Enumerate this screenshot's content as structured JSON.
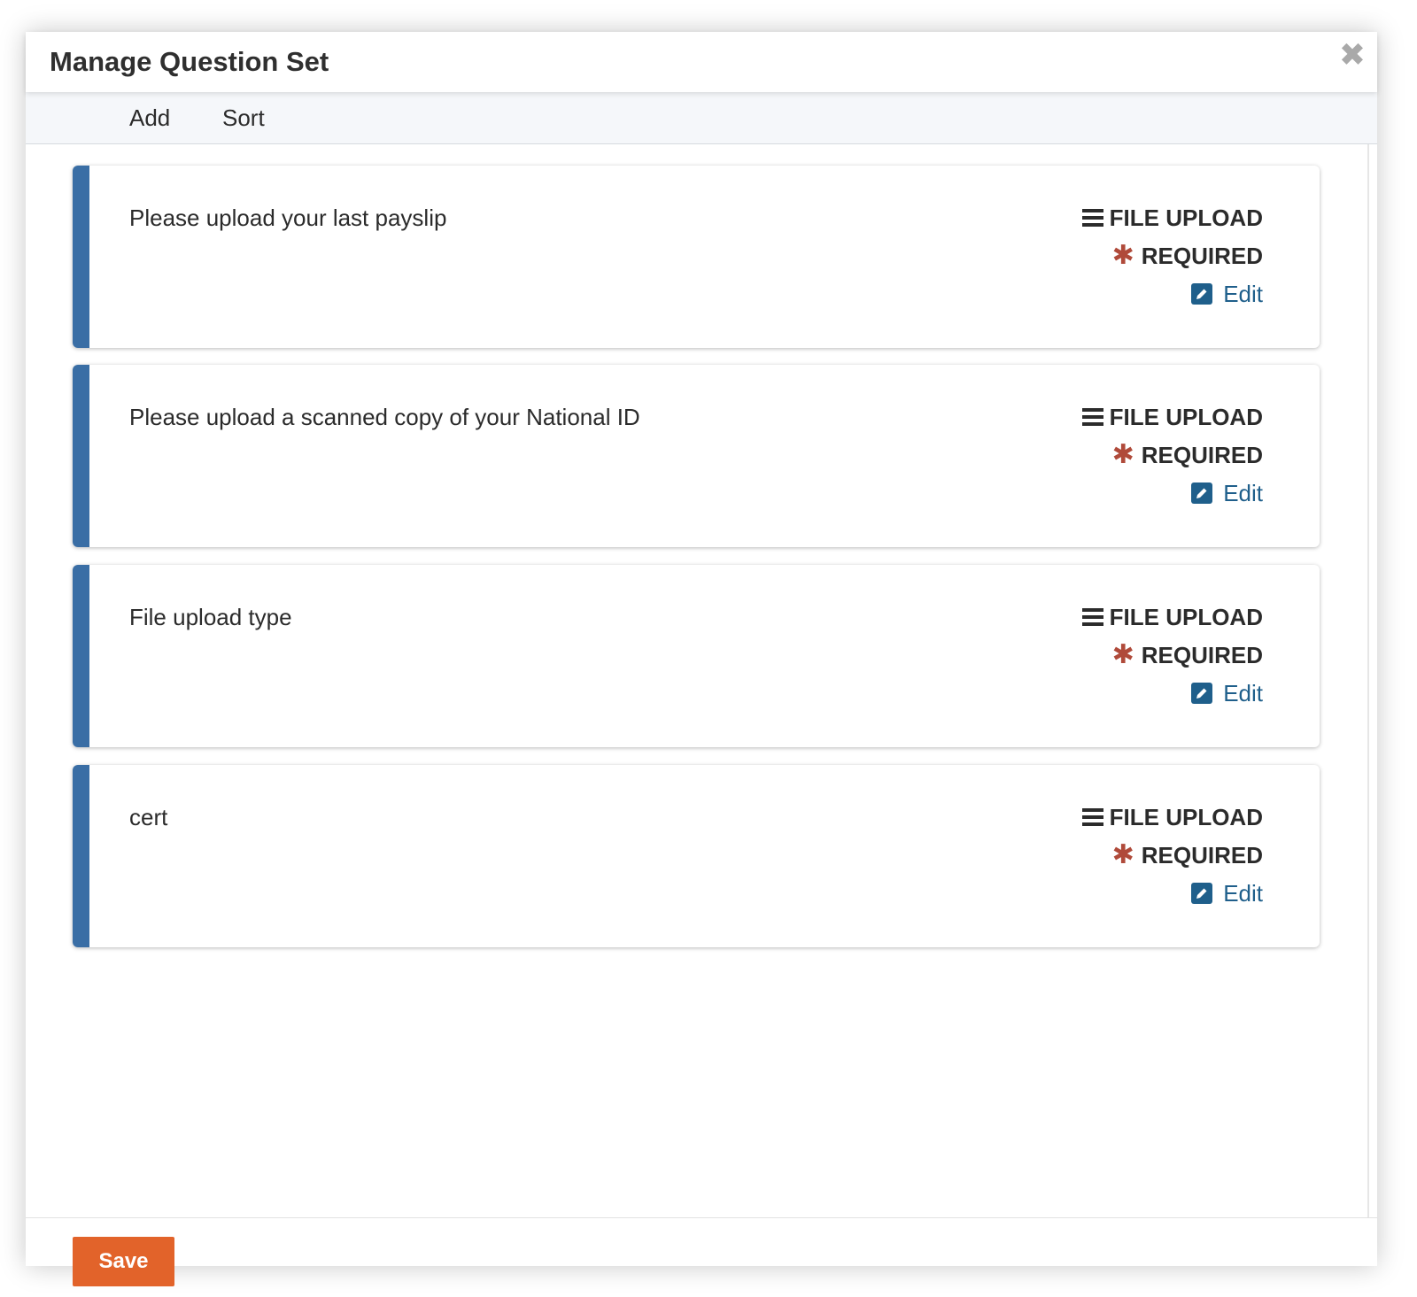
{
  "modal": {
    "title": "Manage Question Set",
    "close_icon": "close-icon"
  },
  "toolbar": {
    "add_label": "Add",
    "sort_label": "Sort"
  },
  "questions": [
    {
      "text": "Please upload your last payslip",
      "type": "FILE UPLOAD",
      "required": "REQUIRED",
      "edit": "Edit"
    },
    {
      "text": "Please upload a scanned copy of your National ID",
      "type": "FILE UPLOAD",
      "required": "REQUIRED",
      "edit": "Edit"
    },
    {
      "text": "File upload type",
      "type": "FILE UPLOAD",
      "required": "REQUIRED",
      "edit": "Edit"
    },
    {
      "text": "cert",
      "type": "FILE UPLOAD",
      "required": "REQUIRED",
      "edit": "Edit"
    }
  ],
  "footer": {
    "save_label": "Save"
  },
  "icons": {
    "type": "list-icon",
    "required": "asterisk-icon",
    "edit": "edit-icon",
    "close": "close-icon"
  },
  "colors": {
    "accent": "#3a6ea5",
    "required": "#b04a3a",
    "link": "#1f5f8b",
    "save": "#e2632a",
    "close": "#a9a9a9"
  }
}
